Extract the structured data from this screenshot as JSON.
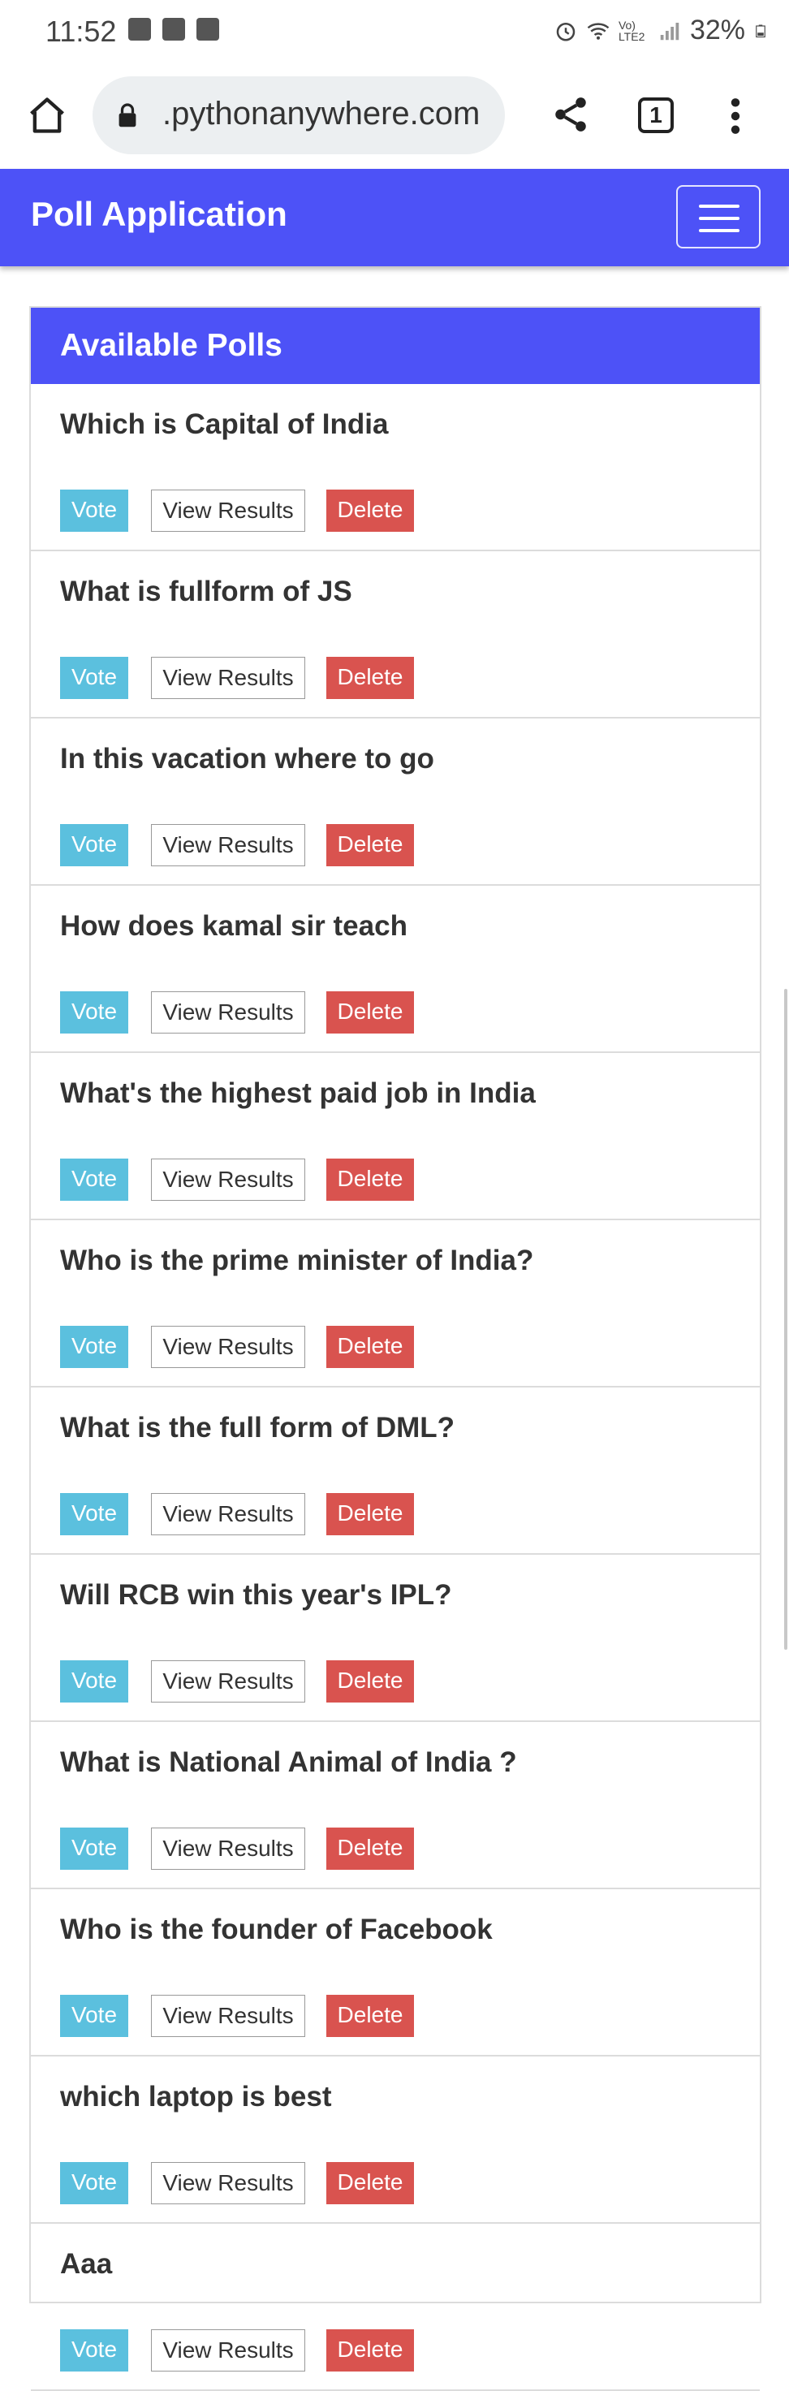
{
  "status_bar": {
    "time": "11:52",
    "battery": "32%",
    "network_label": "Vo) LTE2"
  },
  "browser": {
    "url": ".pythonanywhere.com",
    "tab_count": "1"
  },
  "navbar": {
    "brand": "Poll Application"
  },
  "card": {
    "title": "Available Polls"
  },
  "buttons": {
    "vote": "Vote",
    "view_results": "View Results",
    "delete": "Delete"
  },
  "polls": [
    {
      "question": "Which is Capital of India"
    },
    {
      "question": "What is fullform of JS"
    },
    {
      "question": "In this vacation where to go"
    },
    {
      "question": "How does kamal sir teach"
    },
    {
      "question": "What's the highest paid job in India"
    },
    {
      "question": "Who is the prime minister of India?"
    },
    {
      "question": "What is the full form of DML?"
    },
    {
      "question": "Will RCB win this year's IPL?"
    },
    {
      "question": "What is National Animal of India ?"
    },
    {
      "question": "Who is the founder of Facebook"
    },
    {
      "question": "which laptop is best"
    },
    {
      "question": "Aaa"
    }
  ],
  "colors": {
    "primary": "#4d52f7",
    "vote": "#5bc0de",
    "delete": "#d9534f"
  }
}
